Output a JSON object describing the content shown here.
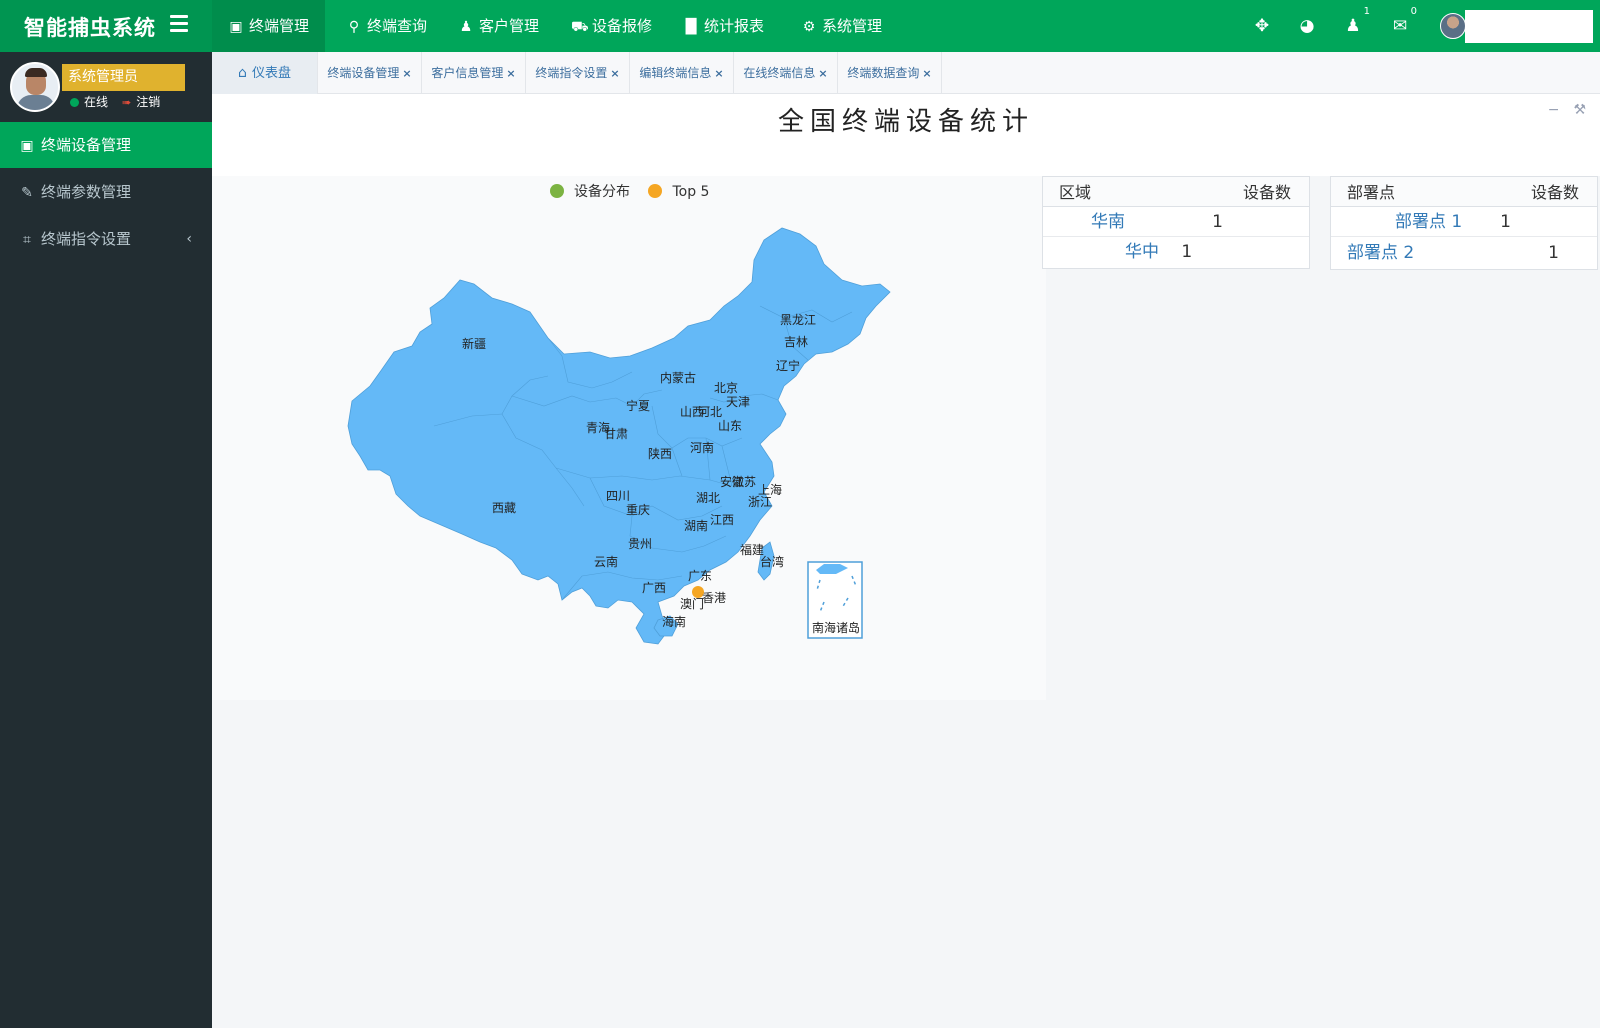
{
  "app": {
    "title": "智能捕虫系统"
  },
  "topnav": {
    "items": [
      {
        "label": "终端管理",
        "icon": "cube-icon"
      },
      {
        "label": "终端查询",
        "icon": "search-icon"
      },
      {
        "label": "客户管理",
        "icon": "users-icon"
      },
      {
        "label": "设备报修",
        "icon": "ambulance-icon"
      },
      {
        "label": "统计报表",
        "icon": "bar-chart-icon"
      },
      {
        "label": "系统管理",
        "icon": "gear-icon"
      }
    ],
    "notification_count": "1",
    "message_count": "0"
  },
  "user": {
    "name": "系统管理员",
    "status_online": "在线",
    "logout": "注销"
  },
  "sidebar": {
    "items": [
      {
        "label": "终端设备管理",
        "icon": "cube-icon"
      },
      {
        "label": "终端参数管理",
        "icon": "edit-icon"
      },
      {
        "label": "终端指令设置",
        "icon": "crop-icon"
      }
    ]
  },
  "tabs": {
    "home": "仪表盘",
    "items": [
      "终端设备管理",
      "客户信息管理",
      "终端指令设置",
      "编辑终端信息",
      "在线终端信息",
      "终端数据查询"
    ]
  },
  "page": {
    "title": "全国终端设备统计"
  },
  "map": {
    "legend": [
      {
        "label": "设备分布",
        "color": "#7cb342"
      },
      {
        "label": "Top 5",
        "color": "#f5a623"
      }
    ],
    "fill_color": "#64b9f7",
    "provinces": [
      "黑龙江",
      "吉林",
      "辽宁",
      "新疆",
      "内蒙古",
      "北京",
      "天津",
      "河北",
      "宁夏",
      "山西",
      "山东",
      "青海",
      "甘肃",
      "河南",
      "陕西",
      "江苏",
      "安徽",
      "上海",
      "湖北",
      "浙江",
      "西藏",
      "四川",
      "重庆",
      "湖南",
      "江西",
      "贵州",
      "福建",
      "云南",
      "台湾",
      "广东",
      "广西",
      "香港",
      "澳门",
      "海南",
      "南海诸岛"
    ]
  },
  "region_table": {
    "headers": [
      "区域",
      "设备数"
    ],
    "rows": [
      {
        "name": "华南",
        "count": "1"
      },
      {
        "name": "华中",
        "count": "1"
      }
    ]
  },
  "site_table": {
    "headers": [
      "部署点",
      "设备数"
    ],
    "rows": [
      {
        "name": "部署点 1",
        "count": "1"
      },
      {
        "name": "部署点 2",
        "count": "1"
      }
    ]
  }
}
